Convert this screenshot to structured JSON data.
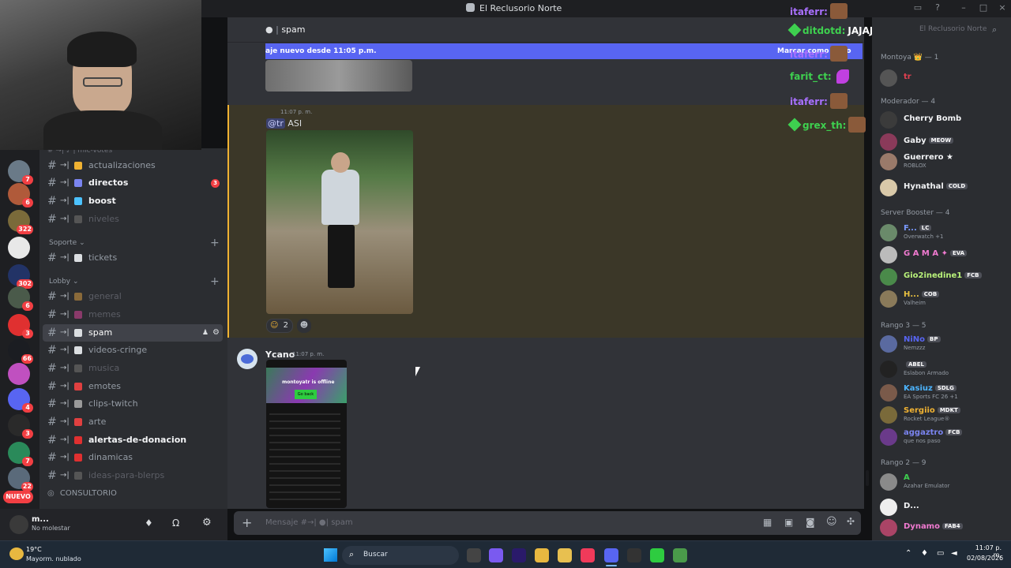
{
  "window": {
    "title": "El Reclusorio Norte"
  },
  "channel_header": {
    "name": "spam"
  },
  "new_messages_bar": {
    "text": "aje nuevo desde 11:05 p.m.",
    "right_text": "Marcar como leído"
  },
  "servers": {
    "badges": [
      "7",
      "6",
      "322",
      "302",
      "6",
      "3",
      "66",
      "4",
      "3",
      "7",
      "22"
    ],
    "new_label": "NUEVO"
  },
  "channels": {
    "items": [
      {
        "label": "actualizaciones",
        "state": "normal"
      },
      {
        "label": "directos",
        "state": "bright",
        "badge": "3"
      },
      {
        "label": "boost",
        "state": "bright"
      },
      {
        "label": "niveles",
        "state": "dim"
      },
      {
        "label": "tickets",
        "state": "normal"
      },
      {
        "label": "general",
        "state": "dim"
      },
      {
        "label": "memes",
        "state": "dim"
      },
      {
        "label": "spam",
        "state": "selected"
      },
      {
        "label": "videos-cringe",
        "state": "normal"
      },
      {
        "label": "musica",
        "state": "dim"
      },
      {
        "label": "emotes",
        "state": "normal"
      },
      {
        "label": "clips-twitch",
        "state": "normal"
      },
      {
        "label": "arte",
        "state": "normal"
      },
      {
        "label": "alertas-de-donacion",
        "state": "bright"
      },
      {
        "label": "dinamicas",
        "state": "normal"
      },
      {
        "label": "ideas-para-blerps",
        "state": "dim"
      }
    ],
    "categories": [
      "Soporte",
      "Lobby"
    ],
    "voice": "CONSULTORIO"
  },
  "user_panel": {
    "name": "m...",
    "status": "No molestar"
  },
  "messages": [
    {
      "time": "11:07 p. m.",
      "mention": "@tr",
      "text": "ASI",
      "reactions": [
        "2"
      ]
    },
    {
      "author": "Ycano",
      "time": "11:07 p. m.",
      "image_text": "montoyatr is offline",
      "image_button": "Go back"
    }
  ],
  "composer": {
    "placeholder": "Mensaje #→|",
    "channel": "spam"
  },
  "overlay_chat": [
    {
      "user": "itaferr:",
      "color": "#a970ff",
      "text": ""
    },
    {
      "user": "ditdotd:",
      "color": "#3ed04f",
      "text": "JAJAJJJAJJA"
    },
    {
      "user": "itaferr:",
      "color": "#a970ff",
      "text": ""
    },
    {
      "user": "farit_ct:",
      "color": "#3ed04f",
      "text": ""
    },
    {
      "user": "itaferr:",
      "color": "#a970ff",
      "text": ""
    },
    {
      "user": "grex_th:",
      "color": "#3ed04f",
      "text": ""
    }
  ],
  "members": {
    "header_right": "El Reclusorio Norte",
    "groups": [
      {
        "title": "Montoya 👑 — 1",
        "members": [
          {
            "name": "tr",
            "tag": "",
            "sub": ""
          }
        ]
      },
      {
        "title": "Moderador — 4",
        "members": [
          {
            "name": "Cherry Bomb",
            "tag": "",
            "sub": ""
          },
          {
            "name": "Gaby",
            "tag": "MEOW",
            "sub": ""
          },
          {
            "name": "Guerrero ★",
            "tag": "",
            "sub": "ROBLOX"
          },
          {
            "name": "Hynathal",
            "tag": "COLD",
            "sub": ""
          }
        ]
      },
      {
        "title": "Server Booster — 4",
        "members": [
          {
            "name": "F...",
            "tag": "LC",
            "sub": "Overwatch +1"
          },
          {
            "name": "G A M A ✦",
            "tag": "EVA",
            "sub": ""
          },
          {
            "name": "Gio2inedine1",
            "tag": "FCB",
            "sub": ""
          },
          {
            "name": "H...",
            "tag": "COB",
            "sub": "Valheim"
          }
        ]
      },
      {
        "title": "Rango 3 — 5",
        "members": [
          {
            "name": "NiNo",
            "tag": "BP",
            "sub": "Nemzzz"
          },
          {
            "name": "",
            "tag": "ABEL",
            "sub": "Eslabon Armado"
          },
          {
            "name": "Kasiuz",
            "tag": "SDLG",
            "sub": "EA Sports FC 26 +1"
          },
          {
            "name": "Sergiio",
            "tag": "MDKT",
            "sub": "Rocket League®"
          },
          {
            "name": "aggaztro",
            "tag": "FCB",
            "sub": "que nos paso"
          }
        ]
      },
      {
        "title": "Rango 2 — 9",
        "members": [
          {
            "name": "A",
            "tag": "",
            "sub": "Azahar Emulator"
          },
          {
            "name": "D...",
            "tag": "",
            "sub": ""
          },
          {
            "name": "Dynamo",
            "tag": "FAB4",
            "sub": ""
          }
        ]
      }
    ]
  },
  "taskbar": {
    "weather_temp": "19°C",
    "weather_desc": "Mayorm. nublado",
    "search": "Buscar",
    "time": "11:07 p. m.",
    "date": "02/08/2026"
  },
  "colors": {
    "accent": "#5865f2",
    "highlight": "#f0b232",
    "danger": "#f23f43",
    "online": "#23a55a"
  }
}
